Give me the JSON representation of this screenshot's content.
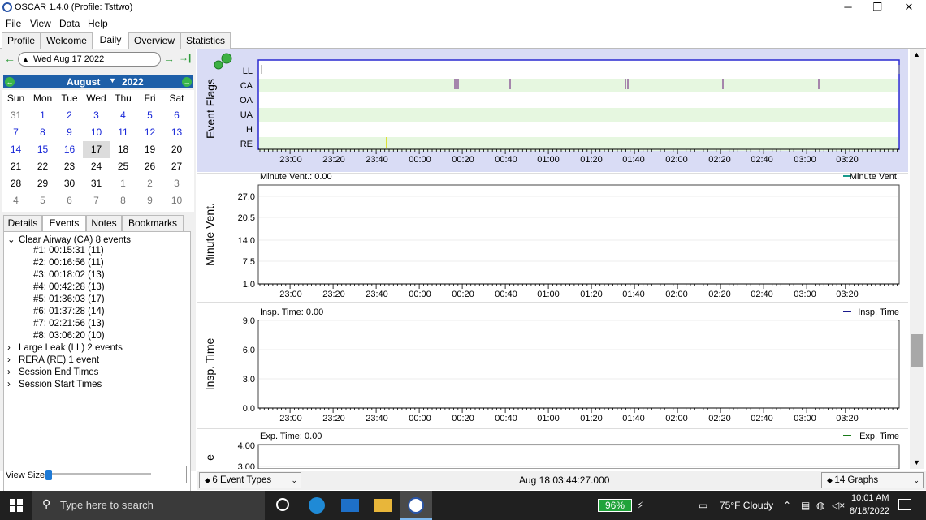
{
  "window": {
    "title": "OSCAR 1.4.0 (Profile: Tsttwo)",
    "minimize": "─",
    "maximize": "❐",
    "close": "✕"
  },
  "menu": [
    "File",
    "View",
    "Data",
    "Help"
  ],
  "tabs": [
    {
      "label": "Profile"
    },
    {
      "label": "Welcome"
    },
    {
      "label": "Daily"
    },
    {
      "label": "Overview"
    },
    {
      "label": "Statistics"
    }
  ],
  "datenav": {
    "prev": "←",
    "date": "Wed Aug 17 2022",
    "next": "→",
    "last": "→|"
  },
  "calendar": {
    "month": "August",
    "year": "2022",
    "weekdays": [
      "Sun",
      "Mon",
      "Tue",
      "Wed",
      "Thu",
      "Fri",
      "Sat"
    ],
    "weeks": [
      [
        "31",
        "1",
        "2",
        "3",
        "4",
        "5",
        "6"
      ],
      [
        "7",
        "8",
        "9",
        "10",
        "11",
        "12",
        "13"
      ],
      [
        "14",
        "15",
        "16",
        "17",
        "18",
        "19",
        "20"
      ],
      [
        "21",
        "22",
        "23",
        "24",
        "25",
        "26",
        "27"
      ],
      [
        "28",
        "29",
        "30",
        "31",
        "1",
        "2",
        "3"
      ],
      [
        "4",
        "5",
        "6",
        "7",
        "8",
        "9",
        "10"
      ]
    ]
  },
  "subtabs": [
    "Details",
    "Events",
    "Notes",
    "Bookmarks"
  ],
  "events": {
    "groups": [
      {
        "label": "Clear Airway (CA) 8 events",
        "expanded": true,
        "items": [
          "#1: 00:15:31 (11)",
          "#2: 00:16:56 (11)",
          "#3: 00:18:02 (13)",
          "#4: 00:42:28 (13)",
          "#5: 01:36:03 (17)",
          "#6: 01:37:28 (14)",
          "#7: 02:21:56 (13)",
          "#8: 03:06:20 (10)"
        ]
      },
      {
        "label": "Large Leak (LL) 2 events",
        "expanded": false
      },
      {
        "label": "RERA (RE) 1 event",
        "expanded": false
      },
      {
        "label": "Session End Times",
        "expanded": false
      },
      {
        "label": "Session Start Times",
        "expanded": false
      }
    ]
  },
  "view_size_label": "View Size",
  "time_ticks": [
    "23:00",
    "23:20",
    "23:40",
    "00:00",
    "00:20",
    "00:40",
    "01:00",
    "01:20",
    "01:40",
    "02:00",
    "02:20",
    "02:40",
    "03:00",
    "03:20"
  ],
  "event_flags": {
    "title": "Event Flags",
    "rows": [
      "LL",
      "CA",
      "OA",
      "UA",
      "H",
      "RE"
    ]
  },
  "graphs": [
    {
      "ylabel": "Minute Vent.",
      "readout": "Minute Vent.: 0.00",
      "legend": "Minute Vent.",
      "color": "#1a9a8c",
      "yticks": [
        "27.0",
        "20.5",
        "14.0",
        "7.5",
        "1.0"
      ]
    },
    {
      "ylabel": "Insp. Time",
      "readout": "Insp. Time: 0.00",
      "legend": "Insp. Time",
      "color": "#1a1a8c",
      "yticks": [
        "9.0",
        "6.0",
        "3.0",
        "0.0"
      ]
    },
    {
      "ylabel": "e",
      "readout": "Exp. Time: 0.00",
      "legend": "Exp. Time",
      "color": "#1a7a1a",
      "yticks": [
        "4.00",
        "3.00"
      ]
    }
  ],
  "bottombar": {
    "event_types": "6 Event Types",
    "timestamp": "Aug 18 03:44:27.000",
    "graphs": "14 Graphs"
  },
  "taskbar": {
    "search_placeholder": "Type here to search",
    "battery": "96%",
    "weather": "75°F  Cloudy",
    "time": "10:01 AM",
    "date": "8/18/2022"
  }
}
